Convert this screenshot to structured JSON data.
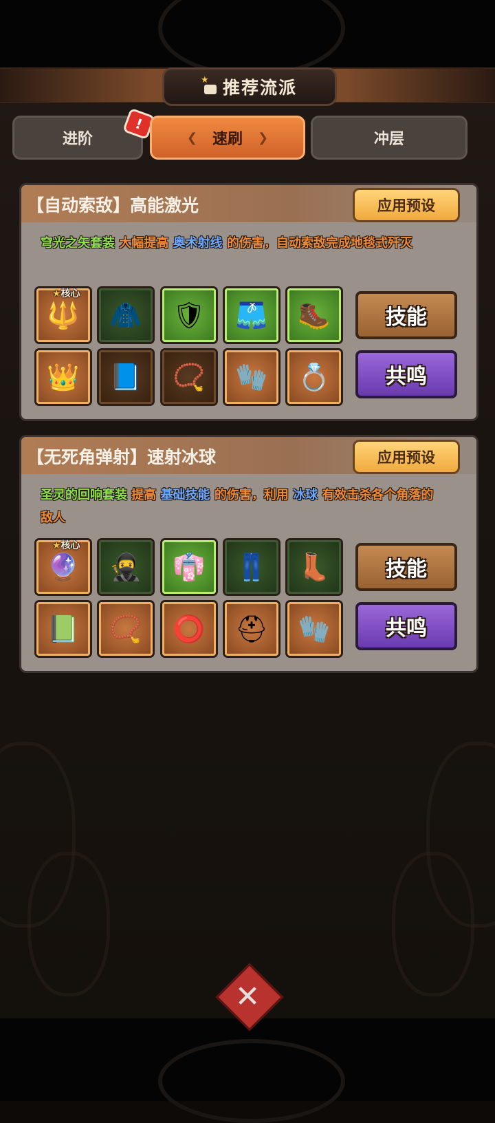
{
  "header": {
    "title": "推荐流派"
  },
  "tabs": [
    {
      "label": "进阶"
    },
    {
      "label": "速刷"
    },
    {
      "label": "冲层"
    }
  ],
  "alert_badge": "!",
  "core_label": "核心",
  "builds": [
    {
      "title": "【自动索敌】高能激光",
      "apply_label": "应用预设",
      "desc": [
        "穹光之矢套装",
        "大幅提高",
        "奥术射线",
        "的伤害，自动索敌完成地毯式歼灭"
      ],
      "skill_label": "技能",
      "resonance_label": "共鸣"
    },
    {
      "title": "【无死角弹射】速射冰球",
      "apply_label": "应用预设",
      "desc": [
        "圣灵的回响套装",
        "提高",
        "基础技能",
        "的伤害，利用",
        "冰球",
        "有效击杀各个角落的敌人"
      ],
      "skill_label": "技能",
      "resonance_label": "共鸣"
    }
  ],
  "icons": {
    "build1": [
      "trident-icon",
      "cloak-icon",
      "chest-armor-icon",
      "leggings-icon",
      "boots-icon",
      "crown-amulet-icon",
      "spellbook-icon",
      "pendant-necklace-icon",
      "gauntlet-icon",
      "ring-icon"
    ],
    "build2": [
      "ice-staff-icon",
      "hood-icon",
      "purple-robe-icon",
      "purple-pants-icon",
      "purple-boots-icon",
      "green-tome-icon",
      "bead-necklace-icon",
      "red-ring-icon",
      "white-helmet-icon",
      "steel-gauntlet-icon"
    ]
  },
  "colors": {
    "accent_orange": "#e07a3a",
    "text_green": "#8fe04a",
    "text_orange": "#f08a34",
    "text_blue": "#6ea8ff",
    "resonance_purple": "#7a48c0"
  }
}
